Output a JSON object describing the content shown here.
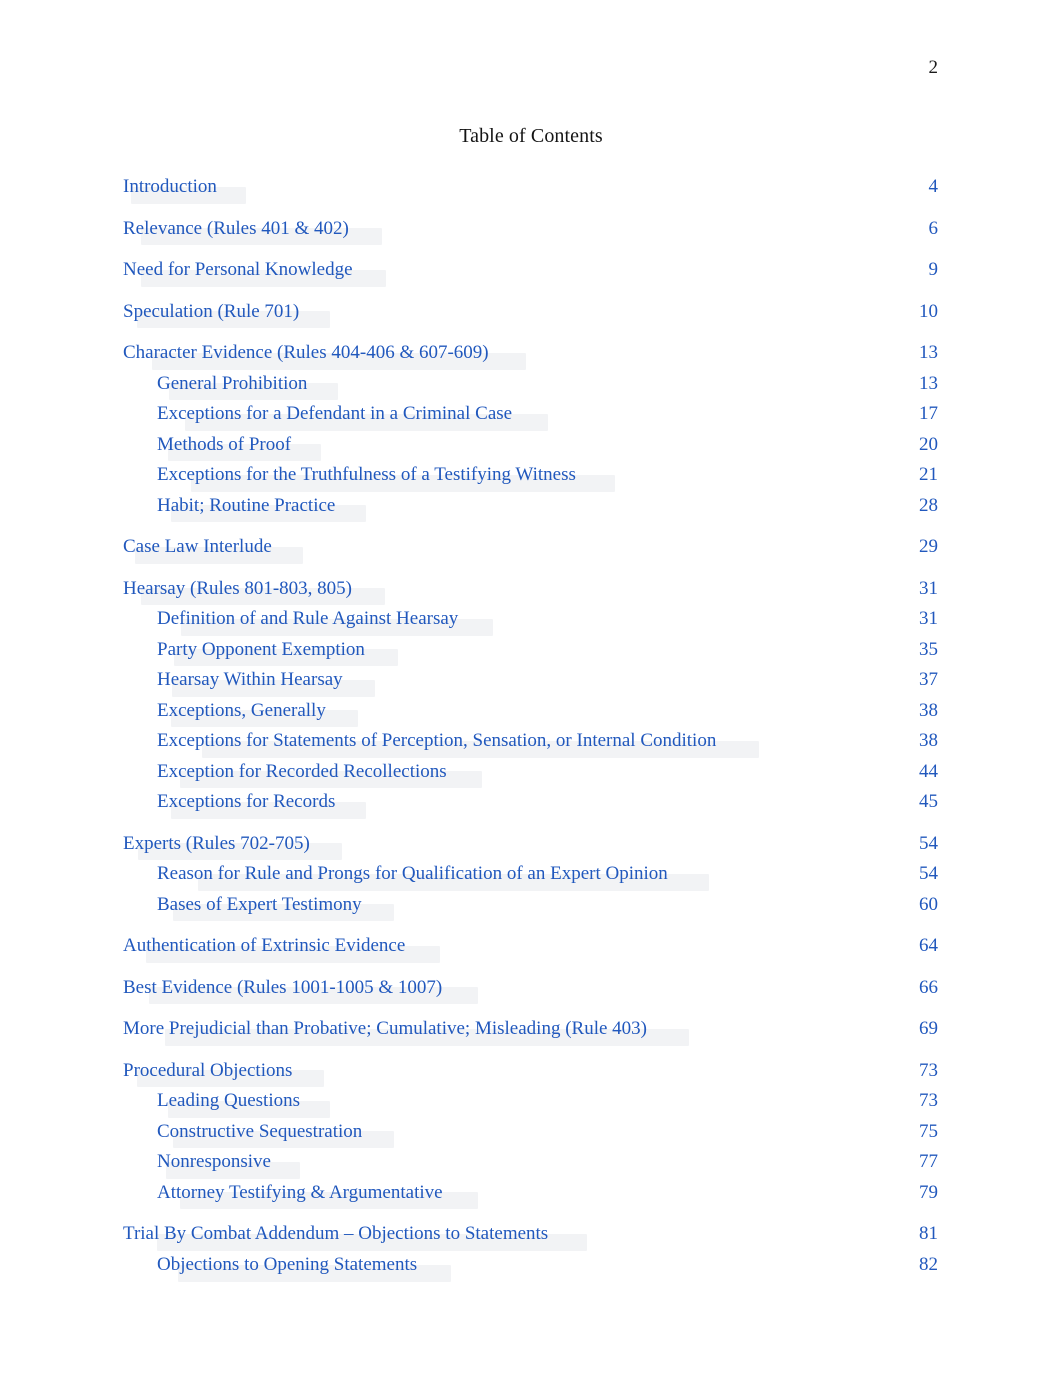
{
  "header": {
    "page_number": "2"
  },
  "title": "Table of Contents",
  "colors": {
    "link_blue": "#2158bd",
    "title_black": "#141414",
    "page_background": "#ffffff"
  },
  "toc": {
    "entries": [
      {
        "level": 1,
        "label": "Introduction",
        "page": "4"
      },
      {
        "level": 1,
        "label": "Relevance (Rules 401 & 402)",
        "page": "6"
      },
      {
        "level": 1,
        "label": "Need for Personal Knowledge",
        "page": "9"
      },
      {
        "level": 1,
        "label": "Speculation (Rule 701)",
        "page": "10"
      },
      {
        "level": 1,
        "label": "Character Evidence (Rules 404-406 & 607-609)",
        "page": "13"
      },
      {
        "level": 2,
        "label": "General Prohibition",
        "page": "13"
      },
      {
        "level": 2,
        "label": "Exceptions for a Defendant in a Criminal Case",
        "page": "17"
      },
      {
        "level": 2,
        "label": "Methods of Proof",
        "page": "20"
      },
      {
        "level": 2,
        "label": "Exceptions for the Truthfulness of a Testifying Witness",
        "page": "21"
      },
      {
        "level": 2,
        "label": "Habit; Routine Practice",
        "page": "28"
      },
      {
        "level": 1,
        "label": "Case Law Interlude",
        "page": "29"
      },
      {
        "level": 1,
        "label": "Hearsay (Rules 801-803, 805)",
        "page": "31"
      },
      {
        "level": 2,
        "label": "Definition of and Rule Against Hearsay",
        "page": "31"
      },
      {
        "level": 2,
        "label": "Party Opponent Exemption",
        "page": "35"
      },
      {
        "level": 2,
        "label": "Hearsay Within Hearsay",
        "page": "37"
      },
      {
        "level": 2,
        "label": "Exceptions, Generally",
        "page": "38"
      },
      {
        "level": 2,
        "label": "Exceptions for Statements of Perception, Sensation, or Internal Condition",
        "page": "38"
      },
      {
        "level": 2,
        "label": "Exception for Recorded Recollections",
        "page": "44"
      },
      {
        "level": 2,
        "label": "Exceptions for Records",
        "page": "45"
      },
      {
        "level": 1,
        "label": "Experts   (Rules 702-705)",
        "page": "54"
      },
      {
        "level": 2,
        "label": "Reason for Rule and Prongs for Qualification of an Expert Opinion",
        "page": "54"
      },
      {
        "level": 2,
        "label": "Bases of Expert Testimony",
        "page": "60"
      },
      {
        "level": 1,
        "label": "Authentication of Extrinsic Evidence",
        "page": "64"
      },
      {
        "level": 1,
        "label": "Best Evidence (Rules 1001-1005 & 1007)",
        "page": "66"
      },
      {
        "level": 1,
        "label": "More Prejudicial than Probative; Cumulative; Misleading (Rule 403)",
        "page": "69"
      },
      {
        "level": 1,
        "label": "Procedural Objections",
        "page": "73"
      },
      {
        "level": 2,
        "label": "Leading Questions",
        "page": "73"
      },
      {
        "level": 2,
        "label": "Constructive Sequestration",
        "page": "75"
      },
      {
        "level": 2,
        "label": "Nonresponsive",
        "page": "77"
      },
      {
        "level": 2,
        "label": "Attorney Testifying & Argumentative",
        "page": "79"
      },
      {
        "level": 1,
        "label": "Trial By Combat Addendum – Objections to Statements",
        "page": "81"
      },
      {
        "level": 2,
        "label": "Objections to Opening Statements",
        "page": "82"
      }
    ]
  }
}
